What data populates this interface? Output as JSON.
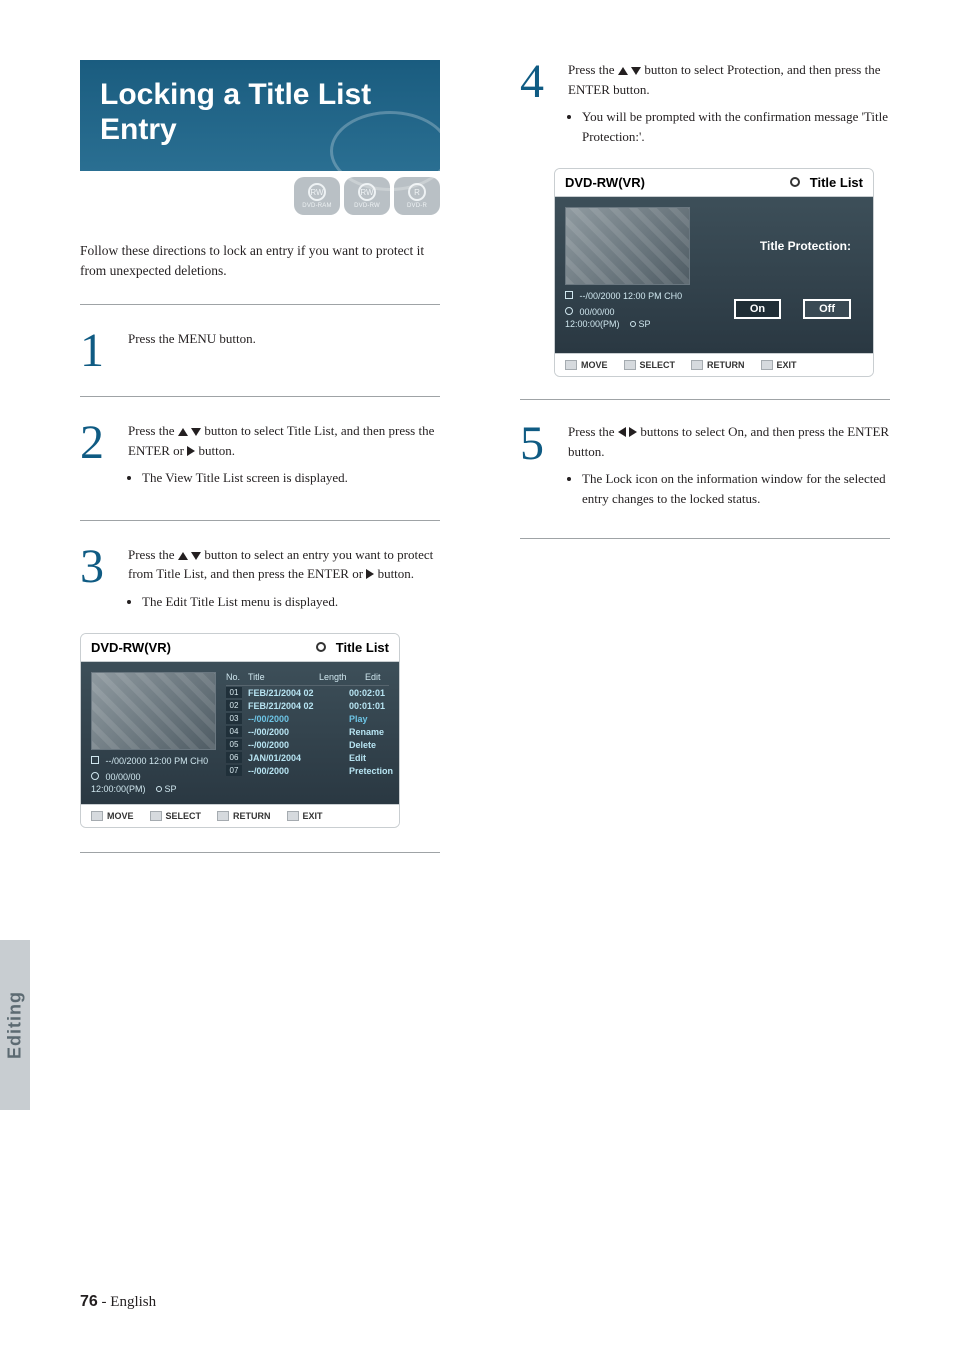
{
  "heading": "Locking a Title List Entry",
  "badges": [
    {
      "icon": "RW",
      "label": "DVD-RAM"
    },
    {
      "icon": "RW",
      "label": "DVD-RW"
    },
    {
      "icon": "R",
      "label": "DVD-R"
    }
  ],
  "intro": "Follow these directions to lock an entry if you want to protect it from unexpected deletions.",
  "steps": {
    "s1": {
      "text": "Press the MENU button."
    },
    "s2": {
      "text_a": "Press the ",
      "text_b": " button to select Title List, and then press the ENTER or ",
      "text_c": " button.",
      "bullet": "The View Title List screen is displayed."
    },
    "s3": {
      "text_a": "Press the ",
      "text_b": " button to select an entry you want to protect from Title List, and then press the ENTER or ",
      "text_c": " button.",
      "bullet": "The Edit Title List menu is displayed."
    },
    "s4": {
      "text_a": "Press the ",
      "text_b": " button to select Protection, and then press the ENTER button.",
      "bullet": "You will be prompted with the confirmation message 'Title Protection:'."
    },
    "s5": {
      "text_a": "Press the ",
      "text_b": " buttons to select On, and then press the ENTER button.",
      "bullet": "The Lock icon on the information window for the selected entry changes to the locked status."
    }
  },
  "osd_list": {
    "hdr_left": "DVD-RW(VR)",
    "hdr_right": "Title List",
    "info1": "--/00/2000 12:00 PM CH0",
    "info2": "00/00/00",
    "info3_time": "12:00:00(PM)",
    "info3_sp": "SP",
    "head": {
      "no": "No.",
      "title": "Title",
      "length": "Length",
      "edit": "Edit"
    },
    "rows": [
      {
        "no": "01",
        "title": "FEB/21/2004 02",
        "len": "00:02:01"
      },
      {
        "no": "02",
        "title": "FEB/21/2004 02",
        "len": "00:01:01"
      },
      {
        "no": "03",
        "title": "--/00/2000",
        "len": "Play"
      },
      {
        "no": "04",
        "title": "--/00/2000",
        "len": "Rename"
      },
      {
        "no": "05",
        "title": "--/00/2000",
        "len": "Delete"
      },
      {
        "no": "06",
        "title": "JAN/01/2004",
        "len": "Edit"
      },
      {
        "no": "07",
        "title": "--/00/2000",
        "len": "Pretection"
      }
    ],
    "footer": {
      "move": "MOVE",
      "select": "SELECT",
      "return": "RETURN",
      "exit": "EXIT"
    }
  },
  "osd_prot": {
    "hdr_left": "DVD-RW(VR)",
    "hdr_right": "Title List",
    "label": "Title Protection:",
    "on": "On",
    "off": "Off",
    "info1": "--/00/2000 12:00 PM CH0",
    "info2": "00/00/00",
    "info3_time": "12:00:00(PM)",
    "info3_sp": "SP",
    "footer": {
      "move": "MOVE",
      "select": "SELECT",
      "return": "RETURN",
      "exit": "EXIT"
    }
  },
  "side_tab": "Editing",
  "page_number": "76",
  "page_lang": "- English"
}
